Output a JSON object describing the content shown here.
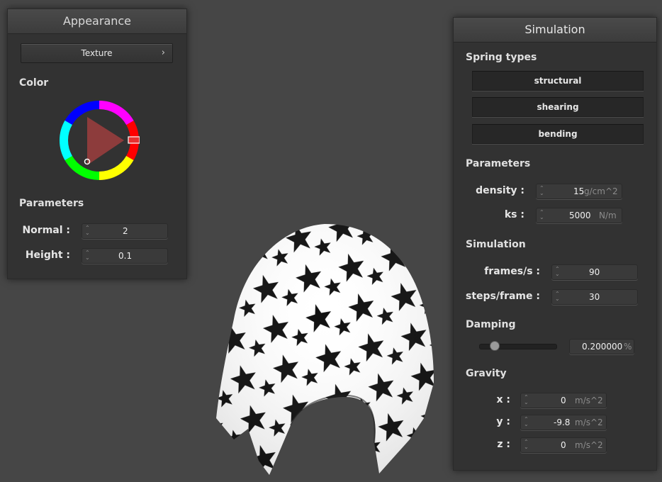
{
  "appearance": {
    "title": "Appearance",
    "texture_label": "Texture",
    "color_label": "Color",
    "parameters_label": "Parameters",
    "normal": {
      "label": "Normal :",
      "value": "2"
    },
    "height": {
      "label": "Height :",
      "value": "0.1"
    }
  },
  "simulation": {
    "title": "Simulation",
    "spring_types_label": "Spring types",
    "springs": [
      "structural",
      "shearing",
      "bending"
    ],
    "parameters_label": "Parameters",
    "density": {
      "label": "density :",
      "value": "15",
      "unit": "g/cm^2"
    },
    "ks": {
      "label": "ks :",
      "value": "5000",
      "unit": "N/m"
    },
    "simulation_label": "Simulation",
    "frames": {
      "label": "frames/s :",
      "value": "90"
    },
    "steps": {
      "label": "steps/frame :",
      "value": "30"
    },
    "damping_label": "Damping",
    "damping": {
      "value": "0.200000",
      "unit": "%",
      "fraction": 0.2
    },
    "gravity_label": "Gravity",
    "gx": {
      "label": "x :",
      "value": "0",
      "unit": "m/s^2"
    },
    "gy": {
      "label": "y :",
      "value": "-9.8",
      "unit": "m/s^2"
    },
    "gz": {
      "label": "z :",
      "value": "0",
      "unit": "m/s^2"
    }
  },
  "colors": {
    "background": "#464646",
    "panel": "#323232",
    "picked_color": "#e83030"
  },
  "icons": {
    "chevron": "chevron-right-icon",
    "spinner": "spinner-arrows-icon"
  }
}
